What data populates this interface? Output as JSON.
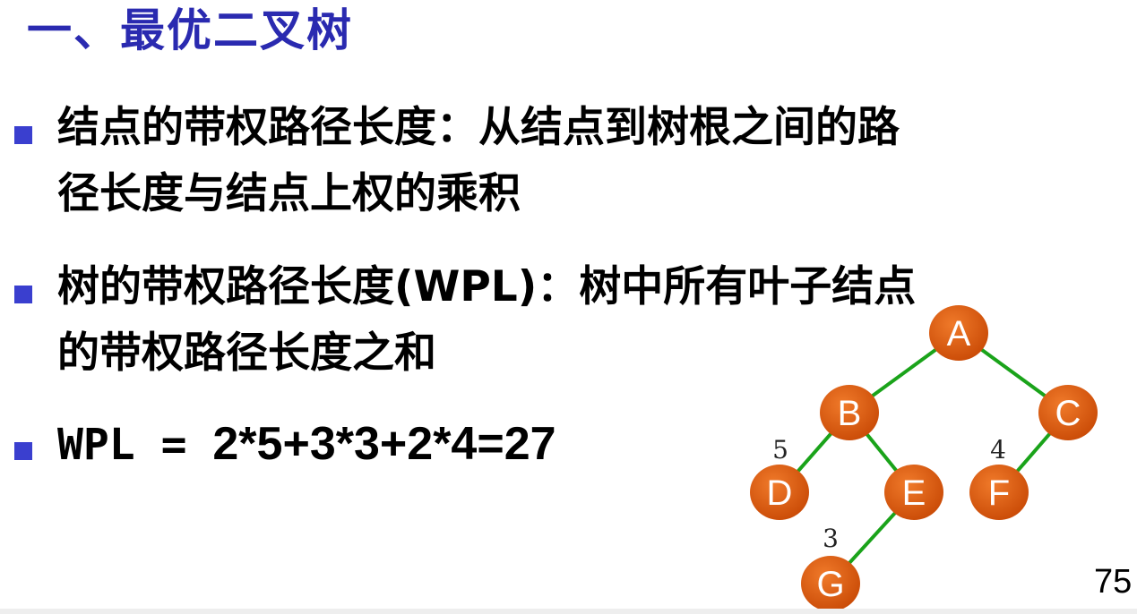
{
  "title": "一、最优二叉树",
  "bullets": [
    {
      "lines": [
        "结点的带权路径长度：从结点到树根之间的路",
        "径长度与结点上权的乘积"
      ]
    },
    {
      "lines": [
        "树的带权路径长度(WPL)：树中所有叶子结点",
        "的带权路径长度之和"
      ]
    },
    {
      "label": "WPL = ",
      "expression": "2*5+3*3+2*4=27"
    }
  ],
  "tree": {
    "nodes": [
      {
        "id": "A",
        "label": "A"
      },
      {
        "id": "B",
        "label": "B"
      },
      {
        "id": "C",
        "label": "C"
      },
      {
        "id": "D",
        "label": "D"
      },
      {
        "id": "E",
        "label": "E"
      },
      {
        "id": "F",
        "label": "F"
      },
      {
        "id": "G",
        "label": "G"
      }
    ],
    "edges": [
      {
        "from": "A",
        "to": "B"
      },
      {
        "from": "A",
        "to": "C"
      },
      {
        "from": "B",
        "to": "D"
      },
      {
        "from": "B",
        "to": "E"
      },
      {
        "from": "C",
        "to": "F"
      },
      {
        "from": "E",
        "to": "G"
      }
    ],
    "weights": [
      {
        "node": "D",
        "label": "5"
      },
      {
        "node": "F",
        "label": "4"
      },
      {
        "node": "G",
        "label": "3"
      }
    ],
    "colors": {
      "edge": "#1aa31a",
      "node_fill": "#e0580b",
      "node_text": "#ffffff"
    }
  },
  "page_number": "75"
}
